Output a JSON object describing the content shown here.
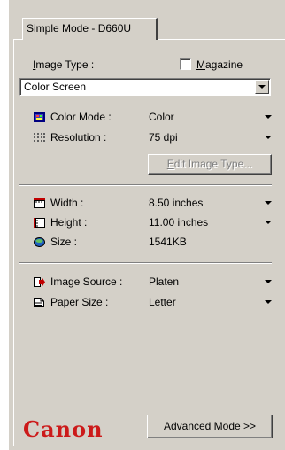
{
  "tab": {
    "label": "Simple Mode - D660U"
  },
  "image_type": {
    "label": "Image Type :",
    "underline": "I",
    "rest": "mage Type :",
    "selected": "Color Screen"
  },
  "magazine": {
    "underline": "M",
    "rest": "agazine",
    "checked": false
  },
  "settings": {
    "color_mode": {
      "label": "Color Mode :",
      "value": "Color"
    },
    "resolution": {
      "label": "Resolution :",
      "value": "75 dpi"
    },
    "edit_button": {
      "underline": "E",
      "rest": "dit Image Type..."
    },
    "width": {
      "label": "Width :",
      "value": "8.50 inches"
    },
    "height": {
      "label": "Height :",
      "value": "11.00 inches"
    },
    "size": {
      "label": "Size :",
      "value": "1541KB"
    },
    "image_source": {
      "label": "Image Source :",
      "value": "Platen"
    },
    "paper_size": {
      "label": "Paper Size :",
      "value": "Letter"
    }
  },
  "footer": {
    "logo": "Canon",
    "advanced_underline": "A",
    "advanced_rest": "dvanced Mode >>"
  },
  "icons": {
    "color_mode": "color-mode-icon",
    "resolution": "resolution-grid-icon",
    "width": "width-ruler-icon",
    "height": "height-ruler-icon",
    "size": "disk-size-icon",
    "image_source": "scanner-source-icon",
    "paper_size": "paper-icon"
  }
}
